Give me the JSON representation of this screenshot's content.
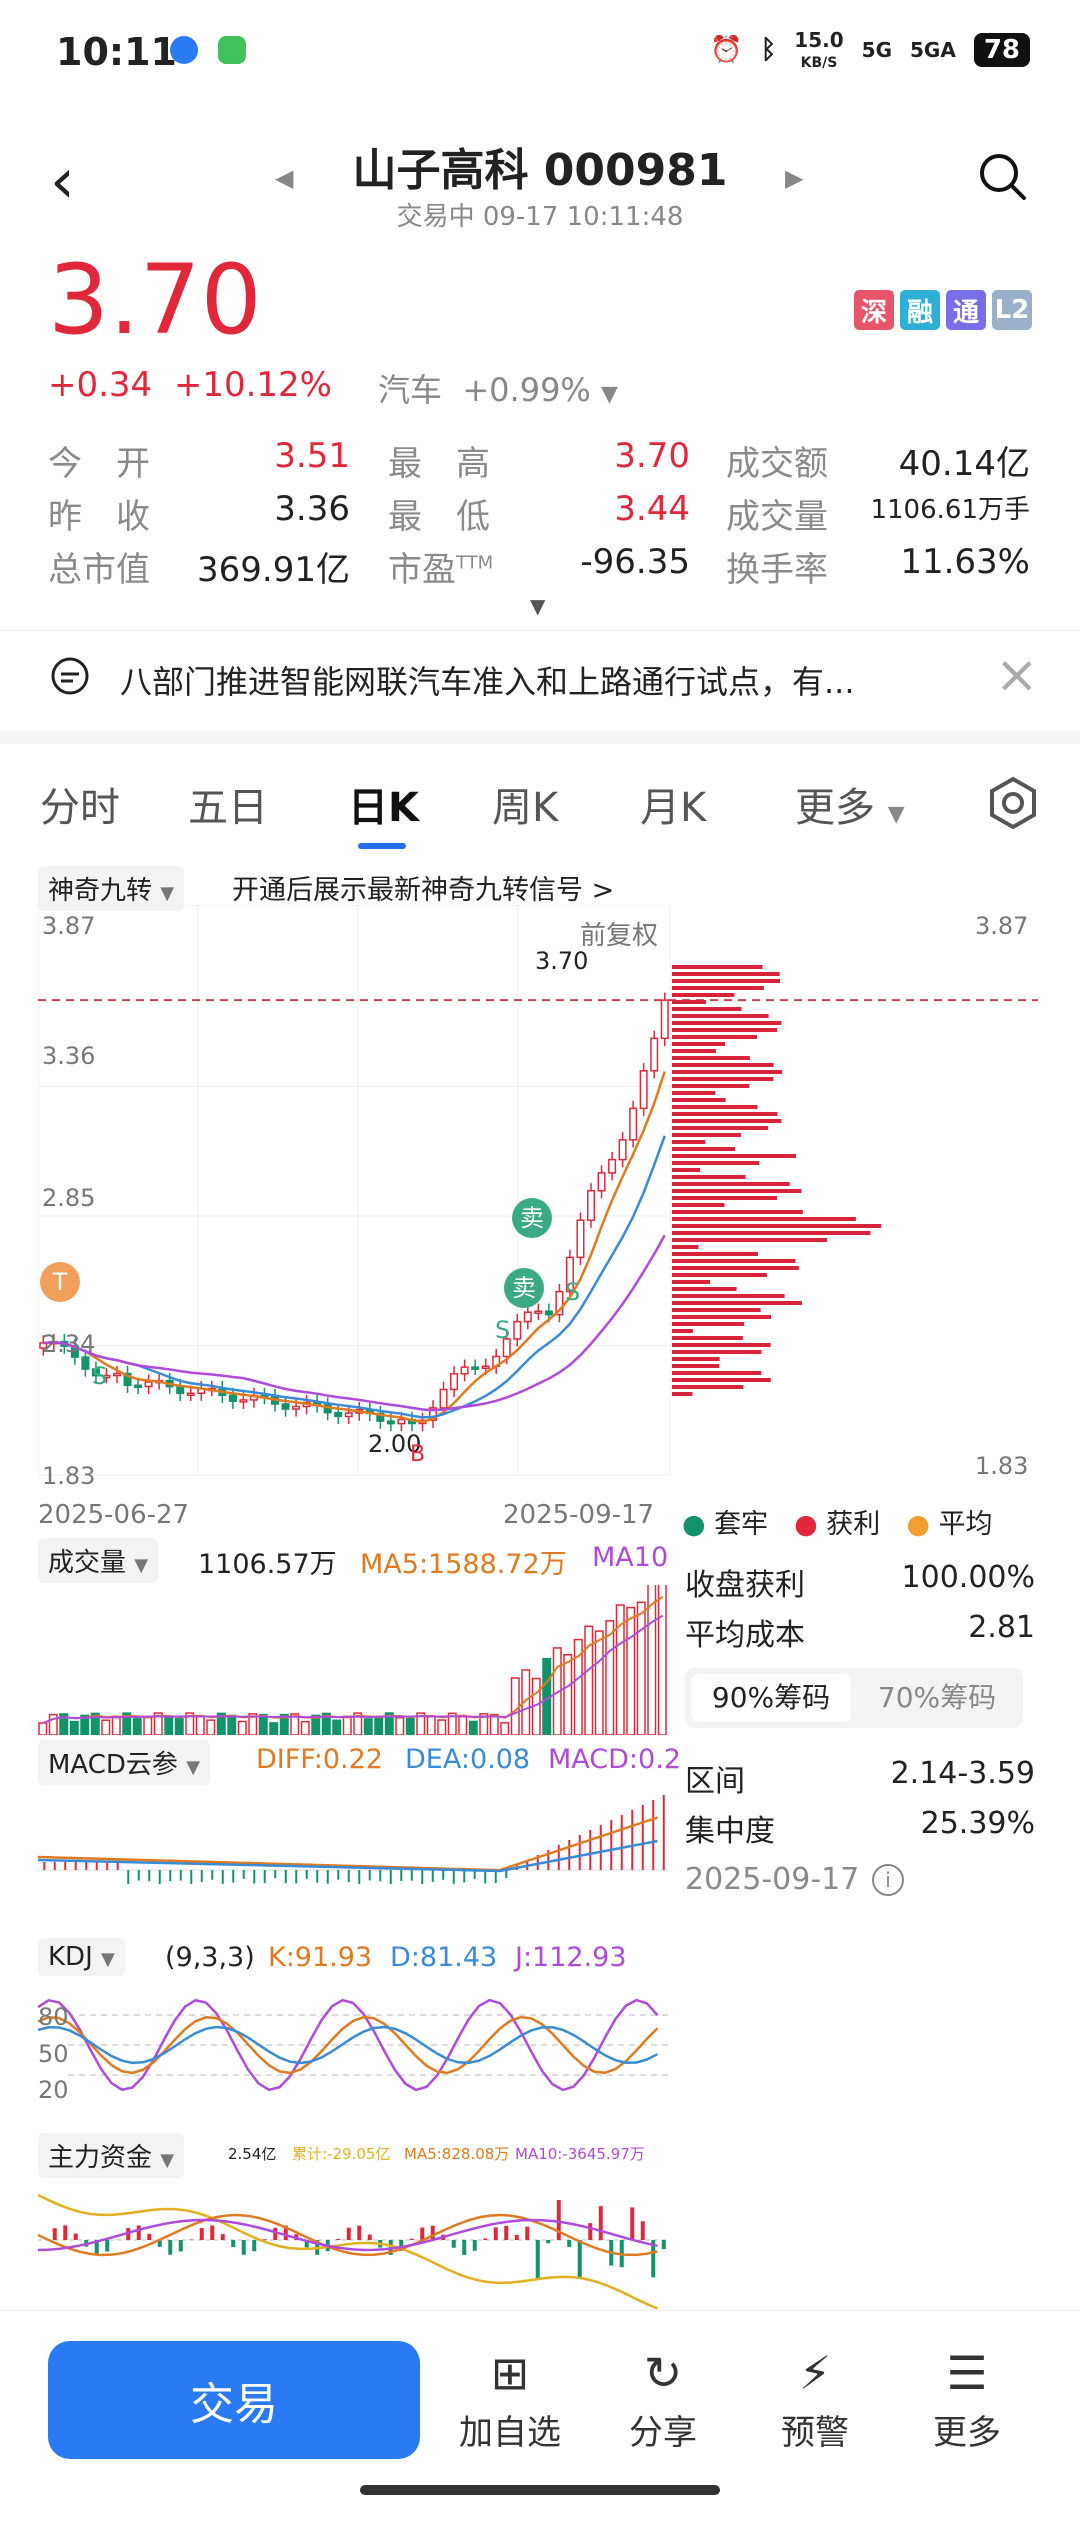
{
  "status": {
    "time": "10:11",
    "speed": "15.0",
    "speed_unit": "KB/S",
    "net1": "5G",
    "net2": "5GA",
    "battery": "78"
  },
  "header": {
    "title": "山子高科 000981",
    "subtitle": "交易中 09-17 10:11:48"
  },
  "quote": {
    "price": "3.70",
    "change": "+0.34",
    "change_pct": "+10.12%",
    "sector": "汽车",
    "sector_pct": "+0.99%",
    "badges": [
      {
        "label": "深",
        "color": "#e8556b"
      },
      {
        "label": "融",
        "color": "#2eb0d6"
      },
      {
        "label": "通",
        "color": "#7a6de8"
      },
      {
        "label": "L2",
        "color": "#9ab0c8"
      }
    ]
  },
  "stats": [
    {
      "k": "今　开",
      "v": "3.51",
      "red": true
    },
    {
      "k": "最　高",
      "v": "3.70",
      "red": true
    },
    {
      "k": "成交额",
      "v": "40.14亿",
      "red": false
    },
    {
      "k": "昨　收",
      "v": "3.36",
      "red": false
    },
    {
      "k": "最　低",
      "v": "3.44",
      "red": true
    },
    {
      "k": "成交量",
      "v": "1106.61万手",
      "red": false
    },
    {
      "k": "总市值",
      "v": "369.91亿",
      "red": false
    },
    {
      "k": "市盈",
      "v": "-96.35",
      "red": false
    },
    {
      "k": "换手率",
      "v": "11.63%",
      "red": false
    }
  ],
  "pe_sup": "TTM",
  "news": "八部门推进智能网联汽车准入和上路通行试点，有...",
  "tabs": [
    "分时",
    "五日",
    "日K",
    "周K",
    "月K",
    "更多"
  ],
  "indicator": {
    "name": "神奇九转",
    "promo": "开通后展示最新神奇九转信号 >"
  },
  "kline": {
    "y_top": "3.87",
    "y_mid1": "3.36",
    "y_mid2": "2.85",
    "y_low": "2.34",
    "y_bottom": "1.83",
    "fq": "前复权",
    "high_mark": "3.70",
    "low_mark": "2.00",
    "date_start": "2025-06-27",
    "date_end": "2025-09-17",
    "sell_label": "卖",
    "t_label": "T",
    "b_label": "B",
    "s_label": "S"
  },
  "chip_legend": [
    {
      "label": "套牢",
      "color": "#12936a"
    },
    {
      "label": "获利",
      "color": "#e0283a"
    },
    {
      "label": "平均",
      "color": "#f0a030"
    }
  ],
  "chip_stats": {
    "profit_k": "收盘获利",
    "profit_v": "100.00%",
    "cost_k": "平均成本",
    "cost_v": "2.81",
    "tab90": "90%筹码",
    "tab70": "70%筹码",
    "range_k": "区间",
    "range_v": "2.14-3.59",
    "conc_k": "集中度",
    "conc_v": "25.39%",
    "date": "2025-09-17"
  },
  "volume": {
    "name": "成交量",
    "value": "1106.57万",
    "ma5": "MA5:1588.72万",
    "ma10": "MA10"
  },
  "macd": {
    "name": "MACD云参",
    "diff": "DIFF:0.22",
    "dea": "DEA:0.08",
    "macd": "MACD:0.2"
  },
  "kdj": {
    "name": "KDJ",
    "params": "(9,3,3)",
    "k": "K:91.93",
    "d": "D:81.43",
    "j": "J:112.93",
    "lv80": "80",
    "lv50": "50",
    "lv20": "20"
  },
  "fund": {
    "name": "主力资金",
    "v1": "2.54亿",
    "v2": "累计:-29.05亿",
    "v3": "MA5:828.08万",
    "v4": "MA10:-3645.97万"
  },
  "bottom": {
    "trade": "交易",
    "buttons": [
      "加自选",
      "分享",
      "预警",
      "更多"
    ]
  },
  "colors": {
    "up": "#e0283a",
    "down": "#12936a",
    "accent": "#2a7bf3"
  }
}
